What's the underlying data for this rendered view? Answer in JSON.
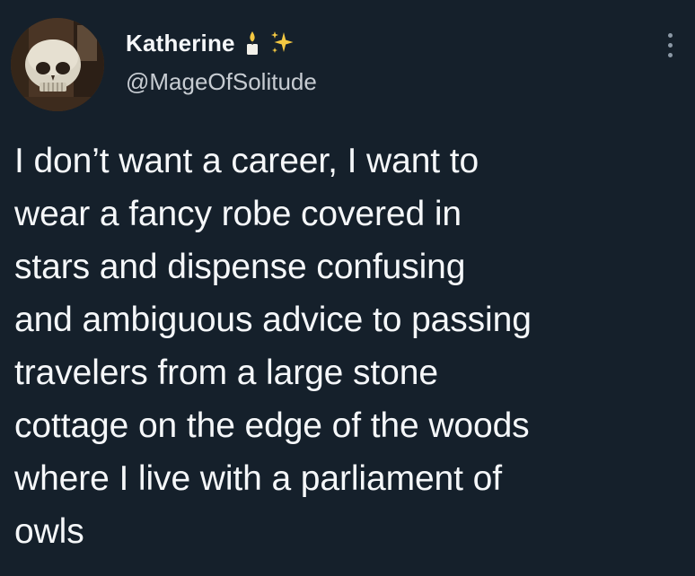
{
  "author": {
    "display_name": "Katherine",
    "name_emojis": [
      "candle-icon",
      "sparkles-icon"
    ],
    "handle": "@MageOfSolitude",
    "avatar": "skull-avatar"
  },
  "tweet": {
    "lines": [
      "I don’t want a career, I want to",
      "wear a fancy robe covered in",
      "stars and dispense confusing",
      "and ambiguous advice to passing",
      "travelers from a large stone",
      "cottage on the edge of the woods",
      "where I live with a parliament of",
      "owls"
    ]
  },
  "colors": {
    "background": "#15202b",
    "text": "#f5f7f9",
    "handle": "#c7ccd2",
    "more_dots": "#8b98a5",
    "sparkle": "#f4c842"
  }
}
